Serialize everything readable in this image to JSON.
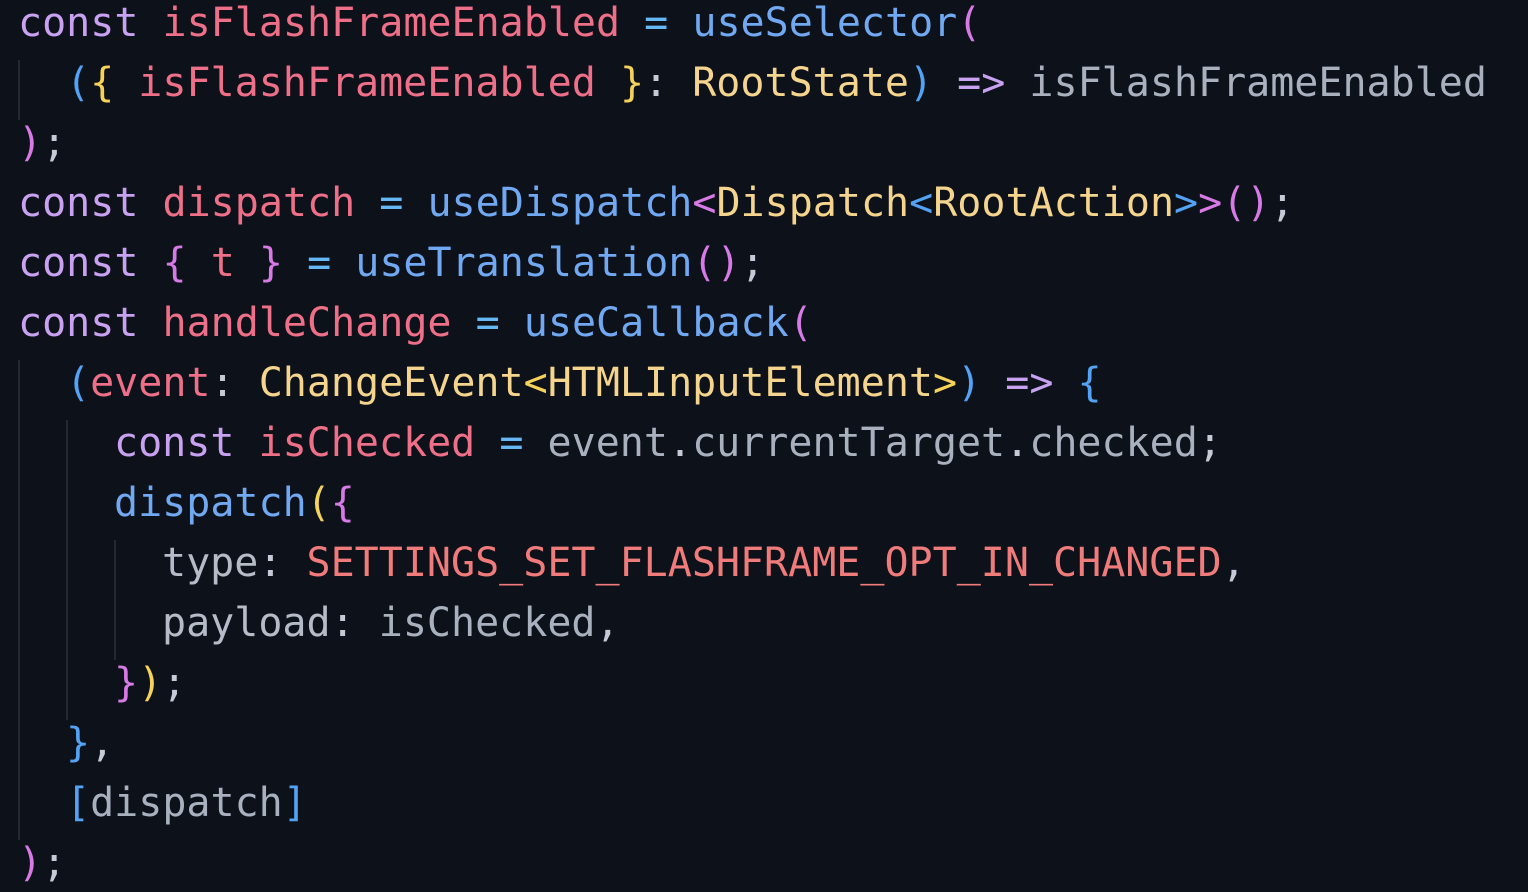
{
  "editor": {
    "background": "#0d111a",
    "colors": {
      "keyword": "#c8a2f0",
      "variable": "#ee6f88",
      "function": "#70a8f2",
      "type": "#f5d58d",
      "operator": "#66b8f5",
      "constant": "#f07b7b",
      "bracket_level_1": "#d77ae6",
      "bracket_level_2": "#f5d25a",
      "bracket_level_3": "#52a3f5"
    },
    "lines": [
      {
        "indent": 0,
        "tokens": [
          {
            "t": "const",
            "c": "kw"
          },
          {
            "t": " ",
            "c": "punct"
          },
          {
            "t": "isFlashFrameEnabled",
            "c": "var"
          },
          {
            "t": " ",
            "c": "punct"
          },
          {
            "t": "=",
            "c": "op"
          },
          {
            "t": " ",
            "c": "punct"
          },
          {
            "t": "useSelector",
            "c": "fn"
          },
          {
            "t": "(",
            "c": "b1"
          }
        ]
      },
      {
        "indent": 1,
        "tokens": [
          {
            "t": "(",
            "c": "b3"
          },
          {
            "t": "{",
            "c": "b2"
          },
          {
            "t": " ",
            "c": "punct"
          },
          {
            "t": "isFlashFrameEnabled",
            "c": "var"
          },
          {
            "t": " ",
            "c": "punct"
          },
          {
            "t": "}",
            "c": "b2"
          },
          {
            "t": ": ",
            "c": "punct"
          },
          {
            "t": "RootState",
            "c": "type"
          },
          {
            "t": ")",
            "c": "b3"
          },
          {
            "t": " ",
            "c": "punct"
          },
          {
            "t": "=>",
            "c": "kw"
          },
          {
            "t": " ",
            "c": "punct"
          },
          {
            "t": "isFlashFrameEnabled",
            "c": "plain"
          }
        ]
      },
      {
        "indent": 0,
        "tokens": [
          {
            "t": ")",
            "c": "b1"
          },
          {
            "t": ";",
            "c": "punct"
          }
        ]
      },
      {
        "indent": 0,
        "tokens": [
          {
            "t": "const",
            "c": "kw"
          },
          {
            "t": " ",
            "c": "punct"
          },
          {
            "t": "dispatch",
            "c": "var"
          },
          {
            "t": " ",
            "c": "punct"
          },
          {
            "t": "=",
            "c": "op"
          },
          {
            "t": " ",
            "c": "punct"
          },
          {
            "t": "useDispatch",
            "c": "fn"
          },
          {
            "t": "<",
            "c": "b1"
          },
          {
            "t": "Dispatch",
            "c": "type"
          },
          {
            "t": "<",
            "c": "b3"
          },
          {
            "t": "RootAction",
            "c": "type"
          },
          {
            "t": ">",
            "c": "b3"
          },
          {
            "t": ">",
            "c": "b1"
          },
          {
            "t": "()",
            "c": "b1"
          },
          {
            "t": ";",
            "c": "punct"
          }
        ]
      },
      {
        "indent": 0,
        "tokens": [
          {
            "t": "const",
            "c": "kw"
          },
          {
            "t": " ",
            "c": "punct"
          },
          {
            "t": "{",
            "c": "b1"
          },
          {
            "t": " ",
            "c": "punct"
          },
          {
            "t": "t",
            "c": "var"
          },
          {
            "t": " ",
            "c": "punct"
          },
          {
            "t": "}",
            "c": "b1"
          },
          {
            "t": " ",
            "c": "punct"
          },
          {
            "t": "=",
            "c": "op"
          },
          {
            "t": " ",
            "c": "punct"
          },
          {
            "t": "useTranslation",
            "c": "fn"
          },
          {
            "t": "()",
            "c": "b1"
          },
          {
            "t": ";",
            "c": "punct"
          }
        ]
      },
      {
        "indent": 0,
        "tokens": [
          {
            "t": "const",
            "c": "kw"
          },
          {
            "t": " ",
            "c": "punct"
          },
          {
            "t": "handleChange",
            "c": "var"
          },
          {
            "t": " ",
            "c": "punct"
          },
          {
            "t": "=",
            "c": "op"
          },
          {
            "t": " ",
            "c": "punct"
          },
          {
            "t": "useCallback",
            "c": "fn"
          },
          {
            "t": "(",
            "c": "b1"
          }
        ]
      },
      {
        "indent": 1,
        "tokens": [
          {
            "t": "(",
            "c": "b3"
          },
          {
            "t": "event",
            "c": "var"
          },
          {
            "t": ": ",
            "c": "punct"
          },
          {
            "t": "ChangeEvent",
            "c": "type"
          },
          {
            "t": "<",
            "c": "b2"
          },
          {
            "t": "HTMLInputElement",
            "c": "type"
          },
          {
            "t": ">",
            "c": "b2"
          },
          {
            "t": ")",
            "c": "b3"
          },
          {
            "t": " ",
            "c": "punct"
          },
          {
            "t": "=>",
            "c": "kw"
          },
          {
            "t": " ",
            "c": "punct"
          },
          {
            "t": "{",
            "c": "b3"
          }
        ]
      },
      {
        "indent": 2,
        "tokens": [
          {
            "t": "const",
            "c": "kw"
          },
          {
            "t": " ",
            "c": "punct"
          },
          {
            "t": "isChecked",
            "c": "var"
          },
          {
            "t": " ",
            "c": "punct"
          },
          {
            "t": "=",
            "c": "op"
          },
          {
            "t": " ",
            "c": "punct"
          },
          {
            "t": "event",
            "c": "plain"
          },
          {
            "t": ".",
            "c": "punct"
          },
          {
            "t": "currentTarget",
            "c": "plain"
          },
          {
            "t": ".",
            "c": "punct"
          },
          {
            "t": "checked",
            "c": "plain"
          },
          {
            "t": ";",
            "c": "punct"
          }
        ]
      },
      {
        "indent": 2,
        "tokens": [
          {
            "t": "dispatch",
            "c": "fn"
          },
          {
            "t": "(",
            "c": "b2"
          },
          {
            "t": "{",
            "c": "b1"
          }
        ]
      },
      {
        "indent": 3,
        "tokens": [
          {
            "t": "type",
            "c": "prop"
          },
          {
            "t": ": ",
            "c": "punct"
          },
          {
            "t": "SETTINGS_SET_FLASHFRAME_OPT_IN_CHANGED",
            "c": "const"
          },
          {
            "t": ",",
            "c": "punct"
          }
        ]
      },
      {
        "indent": 3,
        "tokens": [
          {
            "t": "payload",
            "c": "prop"
          },
          {
            "t": ": ",
            "c": "punct"
          },
          {
            "t": "isChecked",
            "c": "plain"
          },
          {
            "t": ",",
            "c": "punct"
          }
        ]
      },
      {
        "indent": 2,
        "tokens": [
          {
            "t": "}",
            "c": "b1"
          },
          {
            "t": ")",
            "c": "b2"
          },
          {
            "t": ";",
            "c": "punct"
          }
        ]
      },
      {
        "indent": 1,
        "tokens": [
          {
            "t": "}",
            "c": "b3"
          },
          {
            "t": ",",
            "c": "punct"
          }
        ]
      },
      {
        "indent": 1,
        "tokens": [
          {
            "t": "[",
            "c": "b3"
          },
          {
            "t": "dispatch",
            "c": "plain"
          },
          {
            "t": "]",
            "c": "b3"
          }
        ]
      },
      {
        "indent": 0,
        "tokens": [
          {
            "t": ")",
            "c": "b1"
          },
          {
            "t": ";",
            "c": "punct"
          }
        ]
      }
    ]
  }
}
